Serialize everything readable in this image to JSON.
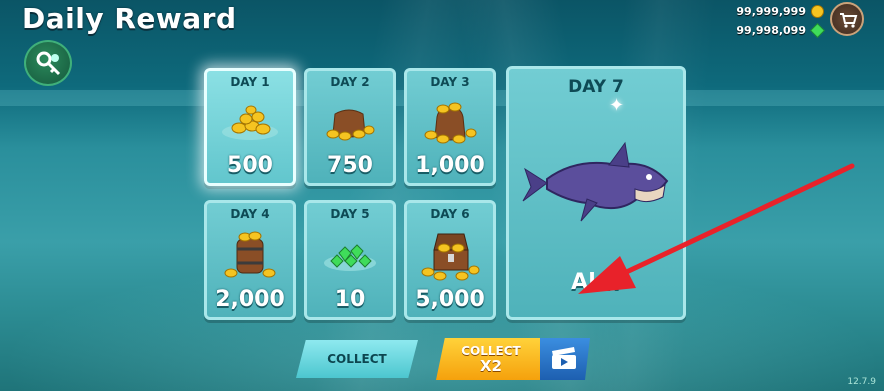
{
  "header": {
    "title": "Daily Reward"
  },
  "currency": {
    "coins": "99,999,999",
    "gems": "99,998,099"
  },
  "rewards": [
    {
      "day": "DAY 1",
      "amount": "500",
      "type": "coins"
    },
    {
      "day": "DAY 2",
      "amount": "750",
      "type": "coin-bag"
    },
    {
      "day": "DAY 3",
      "amount": "1,000",
      "type": "coin-sack"
    },
    {
      "day": "DAY 4",
      "amount": "2,000",
      "type": "coin-barrel"
    },
    {
      "day": "DAY 5",
      "amount": "10",
      "type": "gems"
    },
    {
      "day": "DAY 6",
      "amount": "5,000",
      "type": "treasure-chest"
    }
  ],
  "grand_reward": {
    "day": "DAY 7",
    "name": "Al..."
  },
  "buttons": {
    "collect": "COLLECT",
    "collect_x2_line1": "COLLECT",
    "collect_x2_line2": "X2"
  },
  "version": "12.7.9",
  "colors": {
    "card": "#5fc0c7",
    "accent_gold": "#f5c421",
    "gem_green": "#3fdc5a",
    "annotation_arrow": "#e8222a"
  }
}
